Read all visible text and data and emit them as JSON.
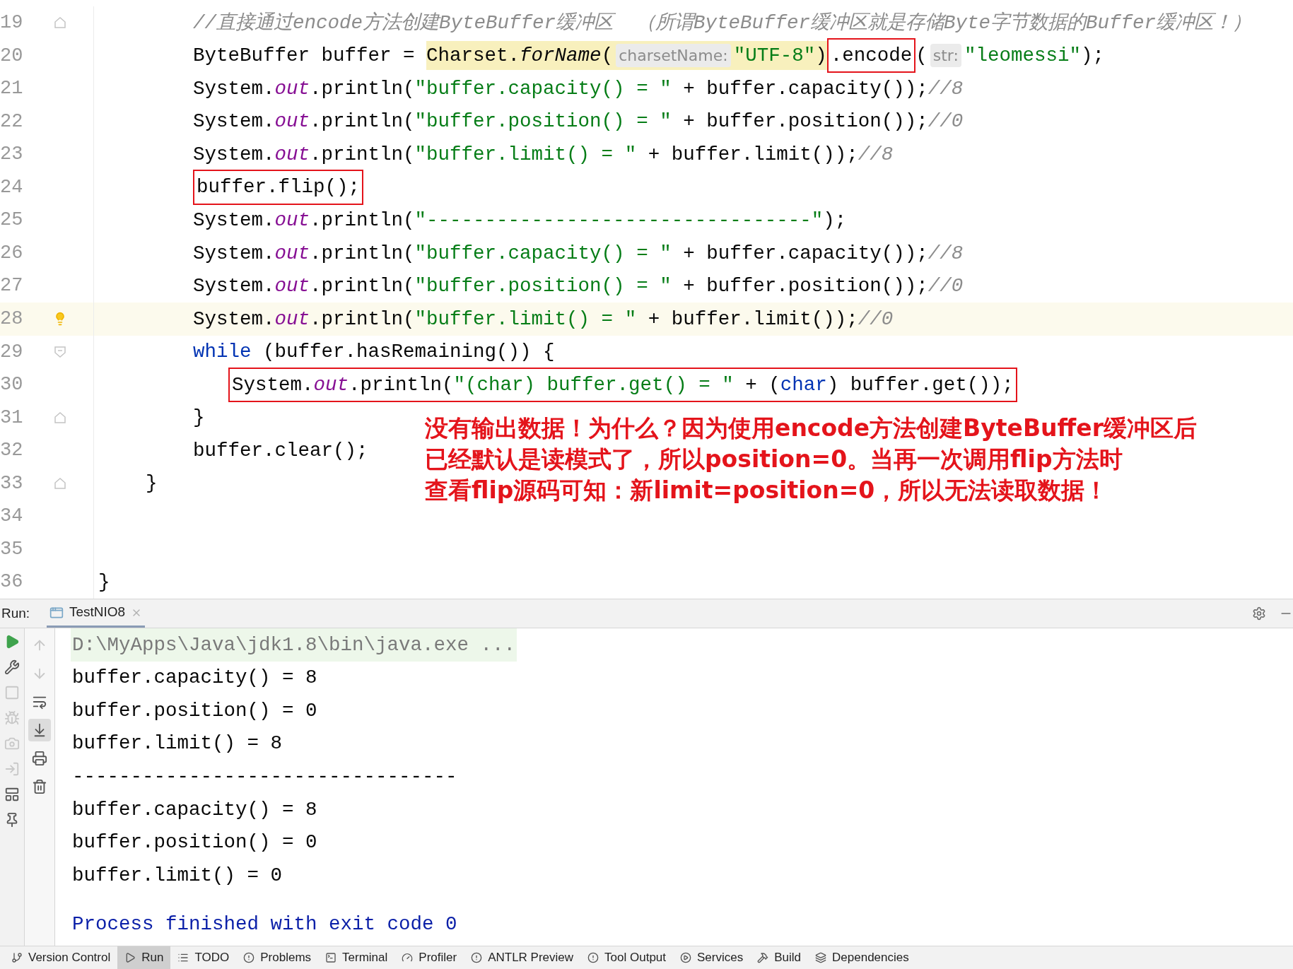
{
  "editor": {
    "lines": [
      {
        "number": "19",
        "kind": "body",
        "gutter": {
          "kind": "fold-close"
        },
        "current": false,
        "segments": [
          {
            "boxed": false,
            "highlighted": false,
            "tokens": [
              {
                "t": "//直接通过encode方法创建ByteBuffer缓冲区  （所谓ByteBuffer缓冲区就是存储Byte字节数据的Buffer缓冲区！）",
                "kind": "comment"
              }
            ]
          }
        ]
      },
      {
        "number": "20",
        "kind": "body",
        "current": false,
        "segments": [
          {
            "boxed": false,
            "highlighted": false,
            "tokens": [
              {
                "t": "ByteBuffer buffer = ",
                "kind": "plain"
              }
            ]
          },
          {
            "boxed": false,
            "highlighted": true,
            "tokens": [
              {
                "t": "Charset.",
                "kind": "plain"
              },
              {
                "t": "forName",
                "kind": "method"
              },
              {
                "t": "(",
                "kind": "plain"
              },
              {
                "t": "charsetName:",
                "kind": "hint"
              },
              {
                "t": "\"UTF-8\"",
                "kind": "string"
              },
              {
                "t": ")",
                "kind": "plain"
              }
            ]
          },
          {
            "boxed": true,
            "highlighted": false,
            "tokens": [
              {
                "t": ".encode",
                "kind": "plain"
              }
            ]
          },
          {
            "boxed": false,
            "highlighted": false,
            "tokens": [
              {
                "t": "(",
                "kind": "plain"
              },
              {
                "t": "str:",
                "kind": "hint"
              },
              {
                "t": "\"leomessi\"",
                "kind": "string"
              },
              {
                "t": ");",
                "kind": "plain"
              }
            ]
          }
        ]
      },
      {
        "number": "21",
        "kind": "body",
        "current": false,
        "segments": [
          {
            "boxed": false,
            "highlighted": false,
            "tokens": [
              {
                "t": "System.",
                "kind": "plain"
              },
              {
                "t": "out",
                "kind": "field"
              },
              {
                "t": ".println(",
                "kind": "plain"
              },
              {
                "t": "\"buffer.capacity() = \"",
                "kind": "string"
              },
              {
                "t": " + buffer.capacity());",
                "kind": "plain"
              },
              {
                "t": "//8",
                "kind": "comment"
              }
            ]
          }
        ]
      },
      {
        "number": "22",
        "kind": "body",
        "current": false,
        "segments": [
          {
            "boxed": false,
            "highlighted": false,
            "tokens": [
              {
                "t": "System.",
                "kind": "plain"
              },
              {
                "t": "out",
                "kind": "field"
              },
              {
                "t": ".println(",
                "kind": "plain"
              },
              {
                "t": "\"buffer.position() = \"",
                "kind": "string"
              },
              {
                "t": " + buffer.position());",
                "kind": "plain"
              },
              {
                "t": "//0",
                "kind": "comment"
              }
            ]
          }
        ]
      },
      {
        "number": "23",
        "kind": "body",
        "current": false,
        "segments": [
          {
            "boxed": false,
            "highlighted": false,
            "tokens": [
              {
                "t": "System.",
                "kind": "plain"
              },
              {
                "t": "out",
                "kind": "field"
              },
              {
                "t": ".println(",
                "kind": "plain"
              },
              {
                "t": "\"buffer.limit() = \"",
                "kind": "string"
              },
              {
                "t": " + buffer.limit());",
                "kind": "plain"
              },
              {
                "t": "//8",
                "kind": "comment"
              }
            ]
          }
        ]
      },
      {
        "number": "24",
        "kind": "body",
        "current": false,
        "segments": [
          {
            "boxed": true,
            "highlighted": false,
            "tokens": [
              {
                "t": "buffer.flip();",
                "kind": "plain"
              }
            ]
          }
        ]
      },
      {
        "number": "25",
        "kind": "body",
        "current": false,
        "segments": [
          {
            "boxed": false,
            "highlighted": false,
            "tokens": [
              {
                "t": "System.",
                "kind": "plain"
              },
              {
                "t": "out",
                "kind": "field"
              },
              {
                "t": ".println(",
                "kind": "plain"
              },
              {
                "t": "\"---------------------------------\"",
                "kind": "string"
              },
              {
                "t": ");",
                "kind": "plain"
              }
            ]
          }
        ]
      },
      {
        "number": "26",
        "kind": "body",
        "current": false,
        "segments": [
          {
            "boxed": false,
            "highlighted": false,
            "tokens": [
              {
                "t": "System.",
                "kind": "plain"
              },
              {
                "t": "out",
                "kind": "field"
              },
              {
                "t": ".println(",
                "kind": "plain"
              },
              {
                "t": "\"buffer.capacity() = \"",
                "kind": "string"
              },
              {
                "t": " + buffer.capacity());",
                "kind": "plain"
              },
              {
                "t": "//8",
                "kind": "comment"
              }
            ]
          }
        ]
      },
      {
        "number": "27",
        "kind": "body",
        "current": false,
        "segments": [
          {
            "boxed": false,
            "highlighted": false,
            "tokens": [
              {
                "t": "System.",
                "kind": "plain"
              },
              {
                "t": "out",
                "kind": "field"
              },
              {
                "t": ".println(",
                "kind": "plain"
              },
              {
                "t": "\"buffer.position() = \"",
                "kind": "string"
              },
              {
                "t": " + buffer.position());",
                "kind": "plain"
              },
              {
                "t": "//0",
                "kind": "comment"
              }
            ]
          }
        ]
      },
      {
        "number": "28",
        "kind": "body",
        "gutter": {
          "kind": "bulb"
        },
        "current": true,
        "segments": [
          {
            "boxed": false,
            "highlighted": false,
            "tokens": [
              {
                "t": "System.",
                "kind": "plain"
              },
              {
                "t": "out",
                "kind": "field"
              },
              {
                "t": ".println(",
                "kind": "plain"
              },
              {
                "t": "\"buffer.limit() = \"",
                "kind": "string"
              },
              {
                "t": " + buffer.limit());",
                "kind": "plain"
              },
              {
                "t": "//0",
                "kind": "comment"
              }
            ]
          }
        ]
      },
      {
        "number": "29",
        "kind": "body",
        "gutter": {
          "kind": "fold-open"
        },
        "current": false,
        "segments": [
          {
            "boxed": false,
            "highlighted": false,
            "tokens": [
              {
                "t": "while",
                "kind": "keyword"
              },
              {
                "t": " (buffer.hasRemaining()) {",
                "kind": "plain"
              }
            ]
          }
        ]
      },
      {
        "number": "30",
        "kind": "nested",
        "current": false,
        "segments": [
          {
            "boxed": true,
            "highlighted": false,
            "tokens": [
              {
                "t": "System.",
                "kind": "plain"
              },
              {
                "t": "out",
                "kind": "field"
              },
              {
                "t": ".println(",
                "kind": "plain"
              },
              {
                "t": "\"(char) buffer.get() = \"",
                "kind": "string"
              },
              {
                "t": " + (",
                "kind": "plain"
              },
              {
                "t": "char",
                "kind": "keyword"
              },
              {
                "t": ") buffer.get());",
                "kind": "plain"
              }
            ]
          }
        ]
      },
      {
        "number": "31",
        "kind": "body",
        "gutter": {
          "kind": "fold-close"
        },
        "current": false,
        "segments": [
          {
            "boxed": false,
            "highlighted": false,
            "tokens": [
              {
                "t": "}",
                "kind": "plain"
              }
            ]
          }
        ]
      },
      {
        "number": "32",
        "kind": "body",
        "current": false,
        "segments": [
          {
            "boxed": false,
            "highlighted": false,
            "tokens": [
              {
                "t": "buffer.clear();",
                "kind": "plain"
              }
            ]
          }
        ]
      },
      {
        "number": "33",
        "kind": "member",
        "gutter": {
          "kind": "fold-close"
        },
        "current": false,
        "segments": [
          {
            "boxed": false,
            "highlighted": false,
            "tokens": [
              {
                "t": "}",
                "kind": "plain"
              }
            ]
          }
        ]
      },
      {
        "number": "34",
        "kind": "top",
        "current": false
      },
      {
        "number": "35",
        "kind": "top",
        "current": false
      },
      {
        "number": "36",
        "kind": "top",
        "current": false,
        "segments": [
          {
            "boxed": false,
            "highlighted": false,
            "tokens": [
              {
                "t": "}",
                "kind": "plain"
              }
            ]
          }
        ]
      }
    ],
    "annotation": [
      "没有输出数据！为什么？因为使用encode方法创建ByteBuffer缓冲区后",
      "已经默认是读模式了，所以position=0。当再一次调用flip方法时",
      "查看flip源码可知：新limit=position=0，所以无法读取数据！"
    ]
  },
  "run_panel": {
    "label": "Run:",
    "tabs": [
      {
        "label": "TestNIO8",
        "selected": true
      }
    ],
    "left_toolbar": [
      {
        "disabled": false
      },
      {
        "disabled": false
      },
      {
        "disabled": true
      },
      {
        "disabled": true
      },
      {
        "disabled": true
      },
      {
        "disabled": true
      },
      {
        "disabled": false
      },
      {
        "disabled": false
      }
    ],
    "console_toolbar": [
      {
        "disabled": true,
        "selected": false
      },
      {
        "disabled": true,
        "selected": false
      },
      {
        "disabled": false,
        "selected": false
      },
      {
        "disabled": false,
        "selected": true
      },
      {
        "disabled": false,
        "selected": false
      },
      {
        "disabled": false,
        "selected": false
      }
    ],
    "output": [
      {
        "kind": "command",
        "text": "D:\\MyApps\\Java\\jdk1.8\\bin\\java.exe ..."
      },
      {
        "kind": "stdout",
        "text": "buffer.capacity() = 8"
      },
      {
        "kind": "stdout",
        "text": "buffer.position() = 0"
      },
      {
        "kind": "stdout",
        "text": "buffer.limit() = 8"
      },
      {
        "kind": "stdout",
        "text": "---------------------------------"
      },
      {
        "kind": "stdout",
        "text": "buffer.capacity() = 8"
      },
      {
        "kind": "stdout",
        "text": "buffer.position() = 0"
      },
      {
        "kind": "stdout",
        "text": "buffer.limit() = 0"
      },
      {
        "kind": "exit",
        "text": "Process finished with exit code 0"
      }
    ]
  },
  "status_bar": [
    {
      "label": "Version Control",
      "selected": false
    },
    {
      "label": "Run",
      "selected": true
    },
    {
      "label": "TODO",
      "selected": false
    },
    {
      "label": "Problems",
      "selected": false
    },
    {
      "label": "Terminal",
      "selected": false
    },
    {
      "label": "Profiler",
      "selected": false
    },
    {
      "label": "ANTLR Preview",
      "selected": false
    },
    {
      "label": "Tool Output",
      "selected": false
    },
    {
      "label": "Services",
      "selected": false
    },
    {
      "label": "Build",
      "selected": false
    },
    {
      "label": "Dependencies",
      "selected": false
    }
  ]
}
